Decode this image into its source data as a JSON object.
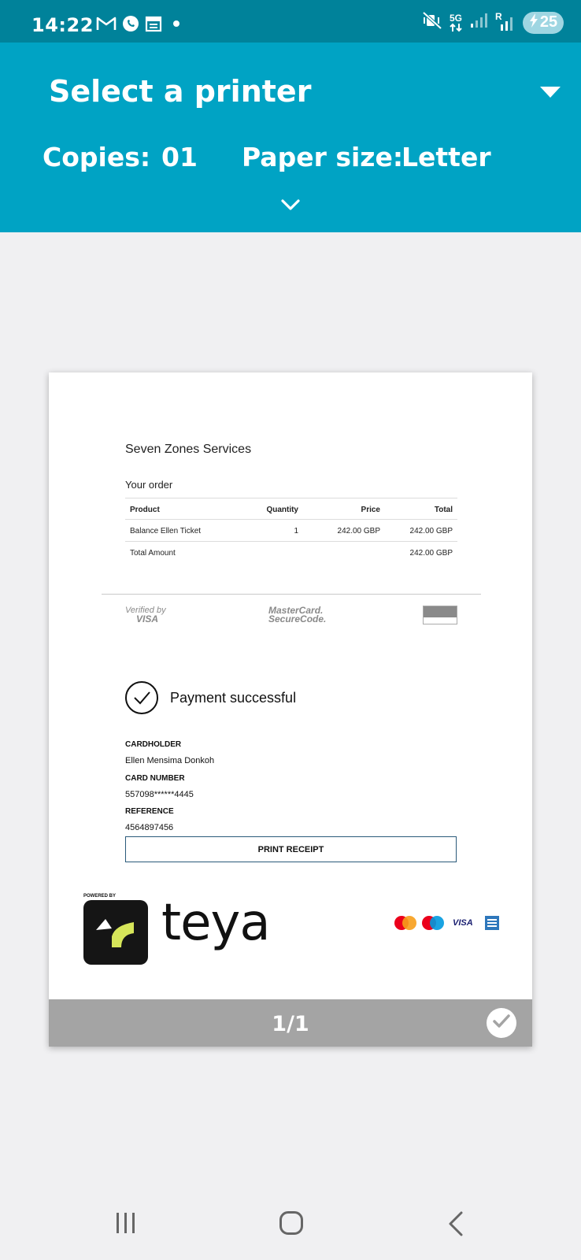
{
  "status_bar": {
    "time": "14:22",
    "left_icons": [
      "gmail-icon",
      "whatsapp-icon",
      "calendar-icon",
      "dot-icon"
    ],
    "network_label": "5G",
    "roaming_label": "R",
    "battery_level": "25",
    "battery_state": "charging"
  },
  "print_header": {
    "printer_label": "Select a printer",
    "copies_label": "Copies:",
    "copies_value": "01",
    "paper_size_label": "Paper size:",
    "paper_size_value": "Letter",
    "background_color": "#00a3c4"
  },
  "receipt": {
    "merchant_name": "Seven Zones Services",
    "order_heading": "Your order",
    "table": {
      "headers": [
        "Product",
        "Quantity",
        "Price",
        "Total"
      ],
      "rows": [
        [
          "Balance Ellen Ticket",
          "1",
          "242.00 GBP",
          "242.00 GBP"
        ]
      ],
      "total_label": "Total Amount",
      "total_value": "242.00 GBP"
    },
    "security_badges": {
      "visa_line1": "Verified by",
      "visa_line2": "VISA",
      "mc_line1": "MasterCard.",
      "mc_line2": "SecureCode."
    },
    "payment_status": "Payment successful",
    "cardholder_label": "CARDHOLDER",
    "cardholder_value": "Ellen Mensima Donkoh",
    "card_number_label": "CARD NUMBER",
    "card_number_value": "557098******4445",
    "reference_label": "REFERENCE",
    "reference_value": "4564897456",
    "print_button_label": "PRINT RECEIPT",
    "powered_by_label": "POWERED BY",
    "brand_name": "teya",
    "card_logos": [
      "mastercard-logo",
      "maestro-logo",
      "visa-logo",
      "amex-logo"
    ],
    "visa_text": "VISA"
  },
  "preview_footer": {
    "page_indicator": "1/1",
    "page_selected": true
  },
  "nav_bar": {
    "buttons": [
      "recent-apps",
      "home",
      "back"
    ]
  }
}
